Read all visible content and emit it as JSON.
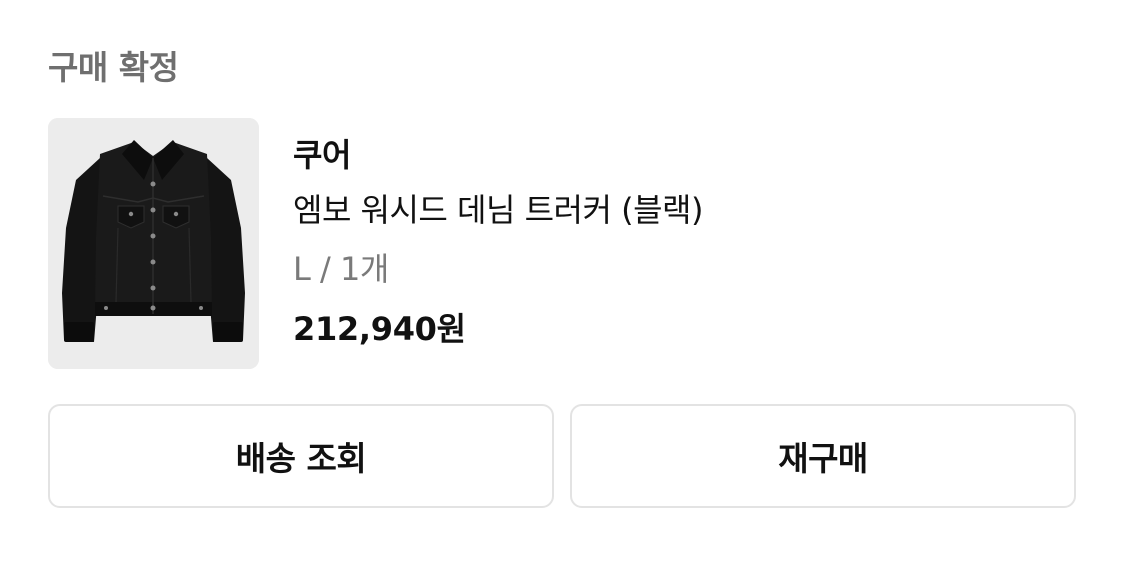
{
  "order": {
    "status_label": "구매 확정",
    "product": {
      "brand": "쿠어",
      "name": "엠보 워시드 데님 트러커 (블랙)",
      "option": "L / 1개",
      "price": "212,940원",
      "image_icon": "black-denim-jacket-image"
    },
    "actions": {
      "track_shipping_label": "배송 조회",
      "repurchase_label": "재구매"
    }
  },
  "colors": {
    "thumb_bg": "#ececec",
    "border": "#e3e3e3",
    "muted_text": "#7a7a7a",
    "title_text": "#6f6f6f"
  }
}
